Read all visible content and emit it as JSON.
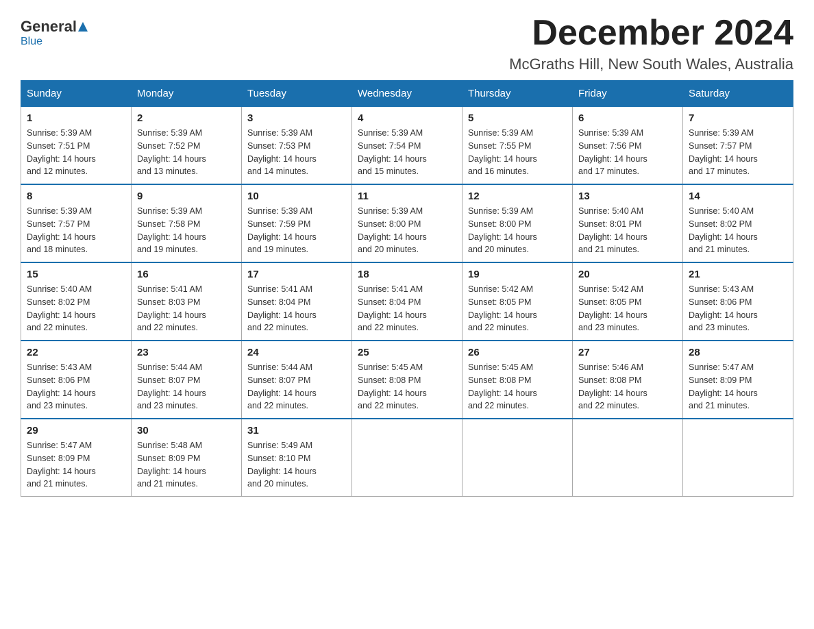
{
  "logo": {
    "general": "General",
    "blue": "Blue",
    "underline": "Blue"
  },
  "header": {
    "month": "December 2024",
    "location": "McGraths Hill, New South Wales, Australia"
  },
  "weekdays": [
    "Sunday",
    "Monday",
    "Tuesday",
    "Wednesday",
    "Thursday",
    "Friday",
    "Saturday"
  ],
  "weeks": [
    [
      {
        "day": "1",
        "sunrise": "5:39 AM",
        "sunset": "7:51 PM",
        "daylight": "14 hours and 12 minutes."
      },
      {
        "day": "2",
        "sunrise": "5:39 AM",
        "sunset": "7:52 PM",
        "daylight": "14 hours and 13 minutes."
      },
      {
        "day": "3",
        "sunrise": "5:39 AM",
        "sunset": "7:53 PM",
        "daylight": "14 hours and 14 minutes."
      },
      {
        "day": "4",
        "sunrise": "5:39 AM",
        "sunset": "7:54 PM",
        "daylight": "14 hours and 15 minutes."
      },
      {
        "day": "5",
        "sunrise": "5:39 AM",
        "sunset": "7:55 PM",
        "daylight": "14 hours and 16 minutes."
      },
      {
        "day": "6",
        "sunrise": "5:39 AM",
        "sunset": "7:56 PM",
        "daylight": "14 hours and 17 minutes."
      },
      {
        "day": "7",
        "sunrise": "5:39 AM",
        "sunset": "7:57 PM",
        "daylight": "14 hours and 17 minutes."
      }
    ],
    [
      {
        "day": "8",
        "sunrise": "5:39 AM",
        "sunset": "7:57 PM",
        "daylight": "14 hours and 18 minutes."
      },
      {
        "day": "9",
        "sunrise": "5:39 AM",
        "sunset": "7:58 PM",
        "daylight": "14 hours and 19 minutes."
      },
      {
        "day": "10",
        "sunrise": "5:39 AM",
        "sunset": "7:59 PM",
        "daylight": "14 hours and 19 minutes."
      },
      {
        "day": "11",
        "sunrise": "5:39 AM",
        "sunset": "8:00 PM",
        "daylight": "14 hours and 20 minutes."
      },
      {
        "day": "12",
        "sunrise": "5:39 AM",
        "sunset": "8:00 PM",
        "daylight": "14 hours and 20 minutes."
      },
      {
        "day": "13",
        "sunrise": "5:40 AM",
        "sunset": "8:01 PM",
        "daylight": "14 hours and 21 minutes."
      },
      {
        "day": "14",
        "sunrise": "5:40 AM",
        "sunset": "8:02 PM",
        "daylight": "14 hours and 21 minutes."
      }
    ],
    [
      {
        "day": "15",
        "sunrise": "5:40 AM",
        "sunset": "8:02 PM",
        "daylight": "14 hours and 22 minutes."
      },
      {
        "day": "16",
        "sunrise": "5:41 AM",
        "sunset": "8:03 PM",
        "daylight": "14 hours and 22 minutes."
      },
      {
        "day": "17",
        "sunrise": "5:41 AM",
        "sunset": "8:04 PM",
        "daylight": "14 hours and 22 minutes."
      },
      {
        "day": "18",
        "sunrise": "5:41 AM",
        "sunset": "8:04 PM",
        "daylight": "14 hours and 22 minutes."
      },
      {
        "day": "19",
        "sunrise": "5:42 AM",
        "sunset": "8:05 PM",
        "daylight": "14 hours and 22 minutes."
      },
      {
        "day": "20",
        "sunrise": "5:42 AM",
        "sunset": "8:05 PM",
        "daylight": "14 hours and 23 minutes."
      },
      {
        "day": "21",
        "sunrise": "5:43 AM",
        "sunset": "8:06 PM",
        "daylight": "14 hours and 23 minutes."
      }
    ],
    [
      {
        "day": "22",
        "sunrise": "5:43 AM",
        "sunset": "8:06 PM",
        "daylight": "14 hours and 23 minutes."
      },
      {
        "day": "23",
        "sunrise": "5:44 AM",
        "sunset": "8:07 PM",
        "daylight": "14 hours and 23 minutes."
      },
      {
        "day": "24",
        "sunrise": "5:44 AM",
        "sunset": "8:07 PM",
        "daylight": "14 hours and 22 minutes."
      },
      {
        "day": "25",
        "sunrise": "5:45 AM",
        "sunset": "8:08 PM",
        "daylight": "14 hours and 22 minutes."
      },
      {
        "day": "26",
        "sunrise": "5:45 AM",
        "sunset": "8:08 PM",
        "daylight": "14 hours and 22 minutes."
      },
      {
        "day": "27",
        "sunrise": "5:46 AM",
        "sunset": "8:08 PM",
        "daylight": "14 hours and 22 minutes."
      },
      {
        "day": "28",
        "sunrise": "5:47 AM",
        "sunset": "8:09 PM",
        "daylight": "14 hours and 21 minutes."
      }
    ],
    [
      {
        "day": "29",
        "sunrise": "5:47 AM",
        "sunset": "8:09 PM",
        "daylight": "14 hours and 21 minutes."
      },
      {
        "day": "30",
        "sunrise": "5:48 AM",
        "sunset": "8:09 PM",
        "daylight": "14 hours and 21 minutes."
      },
      {
        "day": "31",
        "sunrise": "5:49 AM",
        "sunset": "8:10 PM",
        "daylight": "14 hours and 20 minutes."
      },
      null,
      null,
      null,
      null
    ]
  ],
  "labels": {
    "sunrise": "Sunrise:",
    "sunset": "Sunset:",
    "daylight": "Daylight:"
  }
}
